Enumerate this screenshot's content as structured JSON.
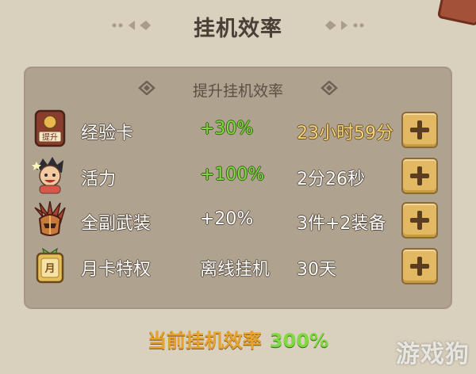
{
  "title": "挂机效率",
  "subtitle": "提升挂机效率",
  "rows": [
    {
      "name": "经验卡",
      "icon": "experience-card-icon",
      "icon_text": "提升",
      "bonus": "+30%",
      "duration": "23小时59分"
    },
    {
      "name": "活力",
      "icon": "vitality-character-icon",
      "bonus": "+100%",
      "duration": "2分26秒"
    },
    {
      "name": "全副武装",
      "icon": "armor-helmet-icon",
      "bonus": "+20%",
      "duration": "3件+2装备"
    },
    {
      "name": "月卡特权",
      "icon": "monthly-card-icon",
      "icon_text": "月",
      "bonus": "离线挂机",
      "duration": "30天"
    }
  ],
  "footer": {
    "label": "当前挂机效率",
    "value": "300%"
  },
  "watermark": "游戏狗",
  "colors": {
    "green": "#7ddc3b",
    "gold": "#f5d37c",
    "orange": "#e8a32c",
    "button": "#e2b862"
  }
}
